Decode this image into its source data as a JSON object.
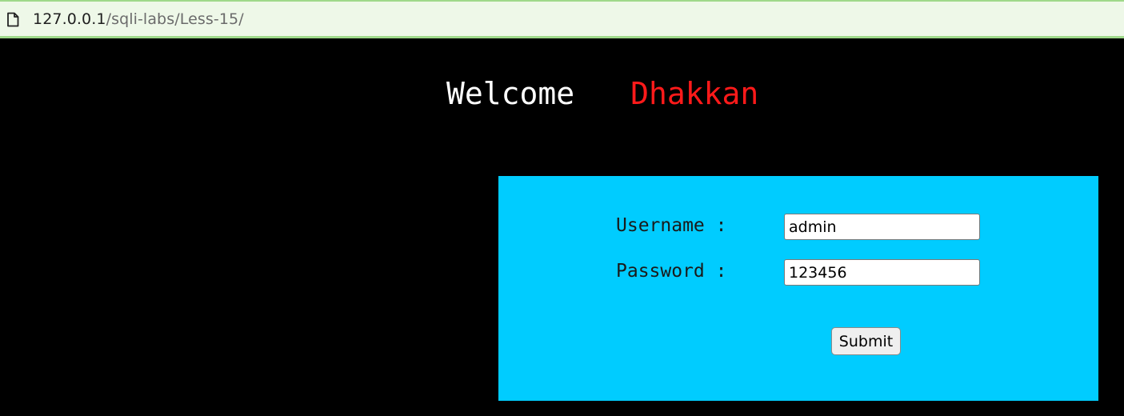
{
  "browser": {
    "url_host": "127.0.0.1",
    "url_path": "/sqli-labs/Less-15/",
    "page_icon": "document-icon"
  },
  "page": {
    "welcome_text": "Welcome",
    "name_text": "Dhakkan",
    "background_color": "#000000",
    "name_color": "#ff1a1a"
  },
  "login_form": {
    "panel_color": "#00ccff",
    "username_label": "Username :",
    "username_value": "admin",
    "password_label": "Password :",
    "password_value": "123456",
    "submit_label": "Submit"
  }
}
